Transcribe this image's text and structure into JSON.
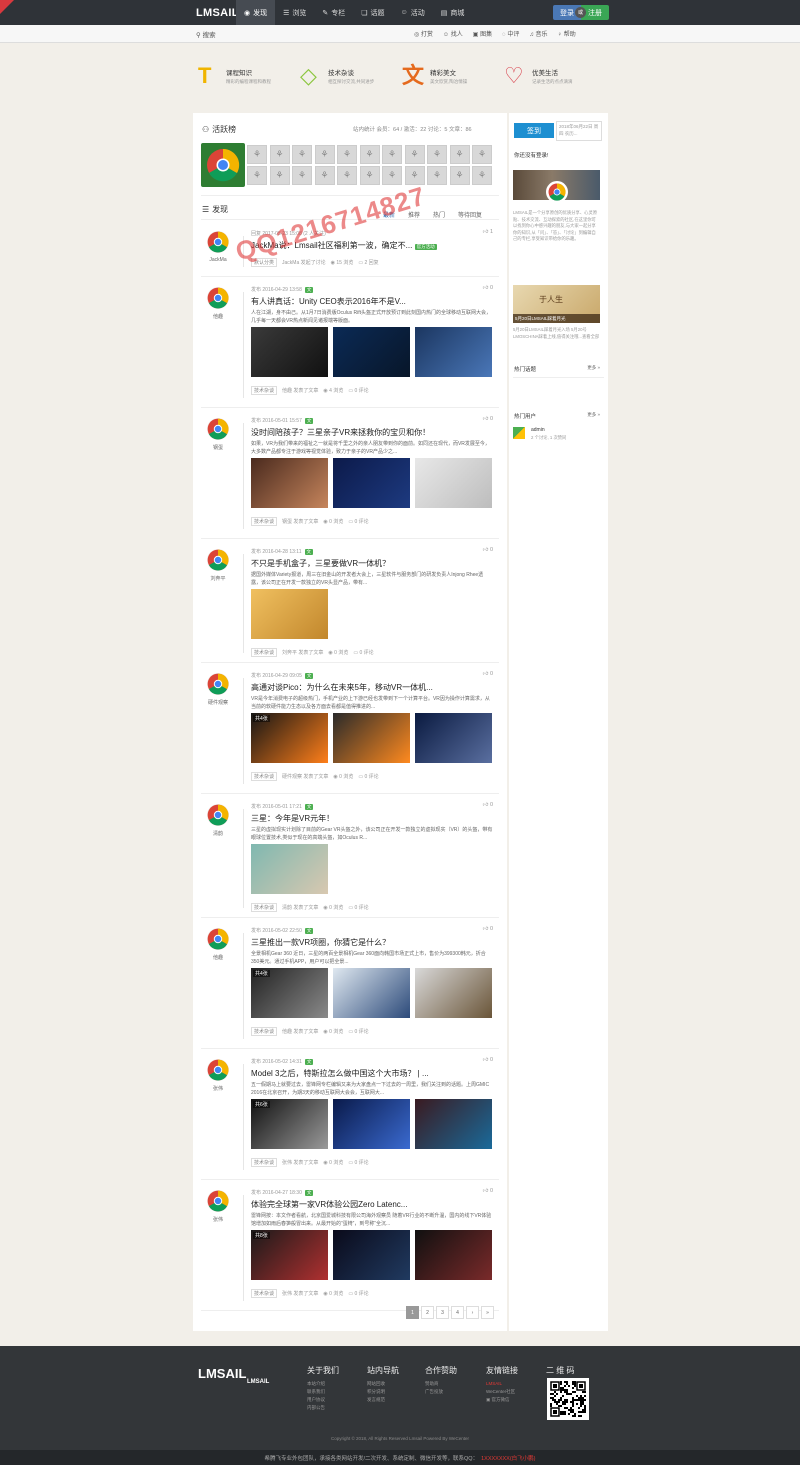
{
  "header": {
    "logo": "LMSAIL",
    "nav": [
      {
        "icon": "eye-icon",
        "label": "发现",
        "active": true
      },
      {
        "icon": "list-icon",
        "label": "浏览"
      },
      {
        "icon": "pen-icon",
        "label": "专栏"
      },
      {
        "icon": "chat-icon",
        "label": "话题"
      },
      {
        "icon": "people-icon",
        "label": "活动"
      },
      {
        "icon": "cart-icon",
        "label": "商城"
      }
    ],
    "login": "登录",
    "or": "或",
    "register": "注册"
  },
  "subbar": {
    "search": "搜索",
    "links": [
      "打赏",
      "找人",
      "图集",
      "中评",
      "音乐",
      "帮助"
    ]
  },
  "features": [
    {
      "icon": "T",
      "title": "课程知识",
      "sub": "精彩的编程课程和教程",
      "color": "#f0b400"
    },
    {
      "icon": "◇",
      "title": "技术杂谈",
      "sub": "相互探讨交流,共同进步",
      "color": "#8cc63f"
    },
    {
      "icon": "文",
      "title": "精彩美文",
      "sub": "美文欣赏,陶冶情操",
      "color": "#e56a1e"
    },
    {
      "icon": "♡",
      "title": "优美生活",
      "sub": "记录生活的点点滴滴",
      "color": "#d9434e"
    }
  ],
  "active_board": {
    "title": "活跃榜",
    "stats": "站内统计   会员：64 / 激活：22   讨论：5   文章：86"
  },
  "discover": {
    "title": "发现",
    "tabs": [
      "最新",
      "推荐",
      "热门",
      "等待回复"
    ]
  },
  "posts": [
    {
      "author": "JackMa",
      "meta": "回复 2017-05-23 15:08 (2 人关注)",
      "tag": "",
      "title": "JackMa说：Lmsail社区福利第一波，确定不...",
      "badge": "官方活动",
      "excerpt": "",
      "images": [],
      "foot_cat": "默认分类",
      "foot_user": "JackMa 发起了讨论",
      "views": "15 浏览",
      "comments": "2 回复",
      "likes": "1"
    },
    {
      "author": "他趣",
      "meta": "发布 2016-04-29 13:58",
      "tag": "文",
      "title": "有人讲真话：Unity CEO表示2016年不是V...",
      "excerpt": "人在江湖，身不由己。从1月7日消费版Oculus Rift头盔正式开放预订到此刻国内热门的全球移动互联网大会，几乎每一天都会VR热点新闻见诸报端等版面。",
      "images": [
        {
          "c1": "#3a3a3a",
          "c2": "#111"
        },
        {
          "c1": "#0b2a55",
          "c2": "#081629"
        },
        {
          "c1": "#1b3660",
          "c2": "#4a77b8"
        }
      ],
      "foot_cat": "技术杂谈",
      "foot_user": "他趣 发表了文章",
      "views": "4 浏览",
      "comments": "0 评论",
      "likes": "0"
    },
    {
      "author": "钢蛋",
      "meta": "发布 2016-05-01 15:57",
      "tag": "文",
      "title": "没时间陪孩子？三星亲子VR来拯救你的宝贝和你！",
      "excerpt": "如果，VR为我们带来的福祉之一就是将千里之外的亲人朋友带到你的面前。如同还在现代，而VR发展至今，大多数产品都专注于游戏等视觉体验，致力于亲子的VR产品少之...",
      "images": [
        {
          "c1": "#4a2a1e",
          "c2": "#c6855c"
        },
        {
          "c1": "#0c1a4a",
          "c2": "#1d3a80"
        },
        {
          "c1": "#e8e8e8",
          "c2": "#bdbdbd"
        }
      ],
      "foot_cat": "技术杂谈",
      "foot_user": "钢蛋 发表了文章",
      "views": "0 浏览",
      "comments": "0 评论",
      "likes": "0"
    },
    {
      "author": "刘奔平",
      "meta": "发布 2016-04-28 13:11",
      "tag": "文",
      "title": "不只是手机盒子，三星要做VR一体机？",
      "excerpt": "据国外媒体Variety报道，周三在旧金山的开发者大会上，三星软件与服务部门的研发负责人Injong Rhee透露，该公司正在开发一款独立的VR头显产品，带有...",
      "images": [
        {
          "c1": "#f0c060",
          "c2": "#c2872c"
        }
      ],
      "foot_cat": "技术杂谈",
      "foot_user": "刘奔平 发表了文章",
      "views": "0 浏览",
      "comments": "0 评论",
      "likes": "0"
    },
    {
      "author": "硬件观察",
      "meta": "发布 2016-04-29 09:05",
      "tag": "文",
      "title": "高通对谈Pico：为什么在未来5年，移动VR一体机...",
      "excerpt": "VR是今年消费电子的超级热门，手机产业的上下游已经也发带到下一个计算平台。VR因为操作计算需求，从当前的软硬件能力生态以及各方面去看都是值得推进的...",
      "images": [
        {
          "c1": "#151515",
          "c2": "#ff7f1a",
          "count": "共4张"
        },
        {
          "c1": "#2a2a2a",
          "c2": "#ff8a1f"
        },
        {
          "c1": "#0a1a40",
          "c2": "#5a6fa0"
        }
      ],
      "foot_cat": "技术杂谈",
      "foot_user": "硬件观察 发表了文章",
      "views": "0 浏览",
      "comments": "0 评论",
      "likes": "0"
    },
    {
      "author": "清韵",
      "meta": "发布 2016-05-01 17:21",
      "tag": "文",
      "title": "三星：今年是VR元年！",
      "excerpt": "三星的虚拟现实计划除了目前的Gear VR头盔之外，该公司正在开发一款独立的虚拟现实（VR）的头盔，带有眼球位置技术,类似于现在的高端头盔，如Oculus R...",
      "images": [
        {
          "c1": "#7fb8b0",
          "c2": "#d8c8b0"
        }
      ],
      "foot_cat": "技术杂谈",
      "foot_user": "清韵 发表了文章",
      "views": "0 浏览",
      "comments": "0 评论",
      "likes": "0"
    },
    {
      "author": "他趣",
      "meta": "发布 2016-05-02 22:50",
      "tag": "文",
      "title": "三星推出一款VR项圈，你猜它是什么？",
      "excerpt": "全景相机Gear 360 近日，三星的两百全景相机Gear 360面向韩国市场正式上市，售价为399300韩元，折合350美元。通过手机APP，用户可以把全景...",
      "images": [
        {
          "c1": "#222",
          "c2": "#8a8a8a",
          "count": "共4张"
        },
        {
          "c1": "#dfe8f0",
          "c2": "#2c4a7a"
        },
        {
          "c1": "#d9d9d9",
          "c2": "#6a5538"
        }
      ],
      "foot_cat": "技术杂谈",
      "foot_user": "他趣 发表了文章",
      "views": "0 浏览",
      "comments": "0 评论",
      "likes": "0"
    },
    {
      "author": "张伟",
      "meta": "发布 2016-05-02 14:31",
      "tag": "文",
      "title": "Model 3之后，特斯拉怎么做中国这个大市场？ | ...",
      "excerpt": "五一假期马上就要过去，雷锋网专栏编辑又来为大家盘点一下过去的一周里，我们关注到的话题。上周GMIC 2016在北京召开，为期3天的移动互联网大会会，互联网大...",
      "images": [
        {
          "c1": "#111",
          "c2": "#9a9a9a",
          "count": "共6张"
        },
        {
          "c1": "#0a1a4a",
          "c2": "#3a6ad0"
        },
        {
          "c1": "#3a1a20",
          "c2": "#1a6a9a"
        }
      ],
      "foot_cat": "技术杂谈",
      "foot_user": "张伟 发表了文章",
      "views": "0 浏览",
      "comments": "0 评论",
      "likes": "0"
    },
    {
      "author": "张伟",
      "meta": "发布 2016-04-27 18:30",
      "tag": "文",
      "title": "体验完全球第一家VR体验公园Zero Latenc...",
      "excerpt": "雷锋网按：本文作者看航，北京国爱城科技有限公司海外观察员 随着VR行业的不断升温，国内的线下VR体验馆增加如雨后春笋般冒出来。从最开始的“蛋椅”，到号称“全沉...",
      "images": [
        {
          "c1": "#1a1a1a",
          "c2": "#b03030",
          "count": "共8张"
        },
        {
          "c1": "#0a0a1a",
          "c2": "#203a60"
        },
        {
          "c1": "#101010",
          "c2": "#7a2a2a"
        }
      ],
      "foot_cat": "技术杂谈",
      "foot_user": "张伟 发表了文章",
      "views": "0 浏览",
      "comments": "0 评论",
      "likes": "0"
    }
  ],
  "pager": [
    "1",
    "2",
    "3",
    "4",
    "›",
    "»"
  ],
  "sidebar": {
    "sign_button": "签到",
    "sign_date": "2018年06月22日 周四 农历...",
    "not_logged": "你还没有登录!",
    "intro": "LMSAIL是一个分享原创的优质分享、心灵原贴、技术交流、互动探索的社区,在这里你可以找到你心中感兴趣的朋友,与大家一起分享你的知识,从「问」、「答」、「讨论」到编辑自己的专栏,享受知识带给你的乐趣。",
    "banner_text": "于人生",
    "news": "5月20日LMSAIL踩着月光入场 5月20号LMOSCHINA踩着上线,值得关注哦...查看全部",
    "news_badge": "5月20日LMSAIL踩着月光",
    "hot_topics": "热门话题",
    "hot_users": "热门用户",
    "more": "更多 »",
    "user_name": "admin",
    "user_stats": "2 个讨论, 1 次赞同"
  },
  "footer": {
    "logo": "LMSAIL",
    "logo_small": "LMSAIL",
    "cols": [
      {
        "title": "关于我们",
        "links": [
          "本站介绍",
          "联系我们",
          "用户协议",
          "内部公告"
        ]
      },
      {
        "title": "站内导航",
        "links": [
          "网站回收",
          "积分说明",
          "发言规范"
        ]
      },
      {
        "title": "合作赞助",
        "links": [
          "赞助商",
          "广告投放"
        ]
      },
      {
        "title": "友情链接",
        "links": [
          "LMSAIL",
          "WeCenter社区",
          "官方微信"
        ]
      },
      {
        "title": "二 维 码",
        "links": []
      }
    ],
    "copyright": "Copyright © 2018, All Rights Reserved Lmsail Powered By WeCenter",
    "bottom": "希腾飞专业外包团队，承接各类网站开发/二次开发、系统定制、微信开发等，联系QQ：",
    "bottom_qq": "1XXXXXXX(白飞小鹏)"
  },
  "watermark": "QQ1216714827"
}
